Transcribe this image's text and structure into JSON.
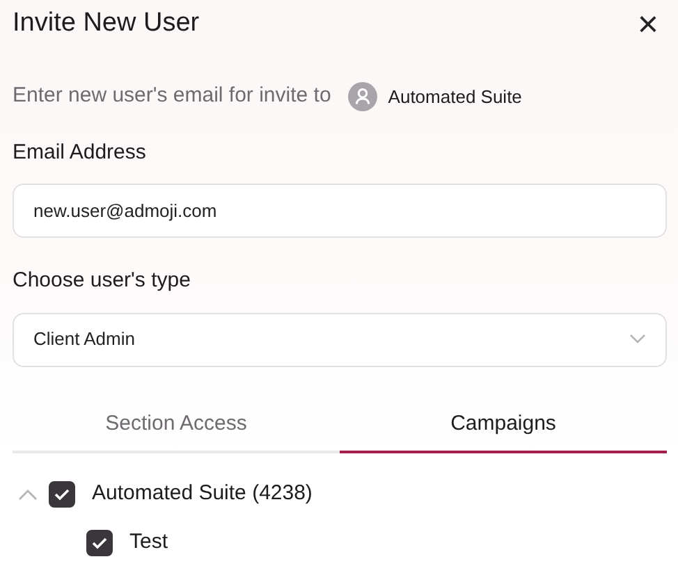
{
  "dialog": {
    "title": "Invite New User",
    "close_label": "×"
  },
  "intro": {
    "text": "Enter new user's email for invite to",
    "workspace": "Automated Suite"
  },
  "email": {
    "label": "Email Address",
    "value": "new.user@admoji.com"
  },
  "user_type": {
    "label": "Choose user's type",
    "value": "Client Admin"
  },
  "tabs": [
    {
      "label": "Section Access",
      "selected": false
    },
    {
      "label": "Campaigns",
      "selected": true
    }
  ],
  "campaigns": [
    {
      "label": "Automated Suite (4238)",
      "checked": true,
      "expanded": true,
      "children": [
        {
          "label": "Test",
          "checked": true
        }
      ]
    }
  ]
}
